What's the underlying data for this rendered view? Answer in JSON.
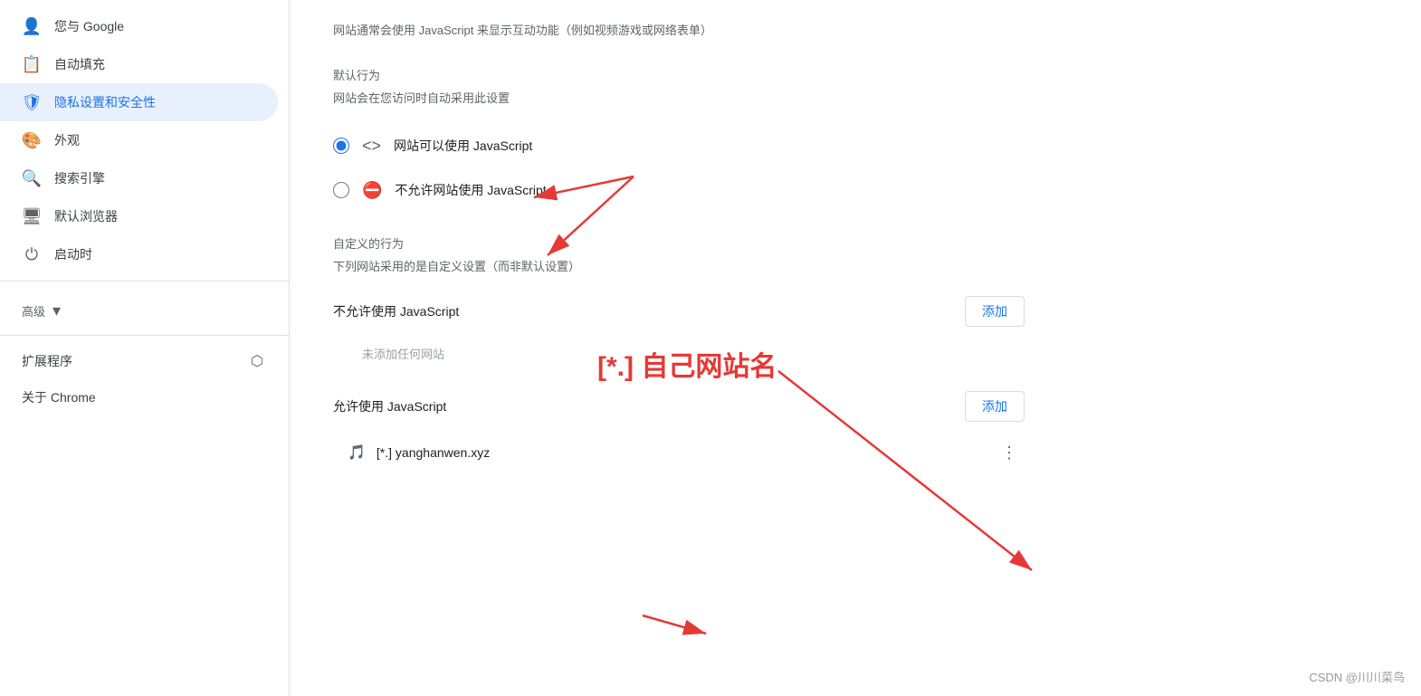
{
  "sidebar": {
    "items": [
      {
        "id": "google",
        "label": "您与 Google",
        "icon": "👤",
        "active": false
      },
      {
        "id": "autofill",
        "label": "自动填充",
        "icon": "📄",
        "active": false
      },
      {
        "id": "privacy",
        "label": "隐私设置和安全性",
        "icon": "🛡",
        "active": true
      },
      {
        "id": "appearance",
        "label": "外观",
        "icon": "🎨",
        "active": false
      },
      {
        "id": "search",
        "label": "搜索引擎",
        "icon": "🔍",
        "active": false
      },
      {
        "id": "browser",
        "label": "默认浏览器",
        "icon": "🖥",
        "active": false
      },
      {
        "id": "startup",
        "label": "启动时",
        "icon": "⏻",
        "active": false
      }
    ],
    "advanced_label": "高级",
    "extensions_label": "扩展程序",
    "about_label": "关于 Chrome"
  },
  "main": {
    "intro_text": "网站通常会使用 JavaScript 来显示互动功能（例如视频游戏或网络表单）",
    "default_behavior_title": "默认行为",
    "default_behavior_subtitle": "网站会在您访问时自动采用此设置",
    "option_allow_label": "网站可以使用 JavaScript",
    "option_allow_icon": "<>",
    "option_deny_label": "不允许网站使用 JavaScript",
    "option_deny_icon": "⛔",
    "custom_behavior_title": "自定义的行为",
    "custom_behavior_subtitle": "下列网站采用的是自定义设置（而非默认设置）",
    "not_allow_title": "不允许使用 JavaScript",
    "not_allow_add_button": "添加",
    "empty_text": "未添加任何网站",
    "allow_title": "允许使用 JavaScript",
    "allow_add_button": "添加",
    "site_entry": "[*.] yanghanwen.xyz",
    "annotation_text": "[*.] 自己网站名",
    "watermark": "CSDN @川川菜鸟"
  }
}
